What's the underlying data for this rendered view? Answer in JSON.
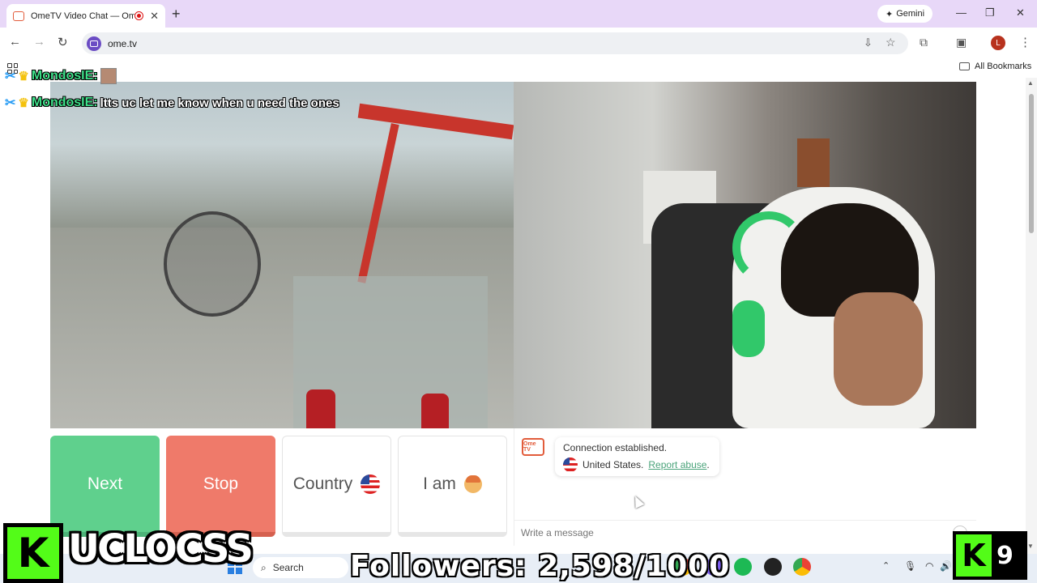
{
  "browser": {
    "tab_title": "OmeTV Video Chat — Ome",
    "new_tab": "+",
    "gemini_label": "Gemini",
    "url": "ome.tv",
    "profile_initial": "L",
    "all_bookmarks": "All Bookmarks"
  },
  "overlay": {
    "row1_name": "MondosIE:",
    "row2_name": "MondosIE:",
    "row2_message": "ltts uc let me know when u need the ones"
  },
  "controls": {
    "next_label": "Next",
    "stop_label": "Stop",
    "country_label": "Country",
    "iam_label": "I am"
  },
  "chat": {
    "logo_text": "Ome TV",
    "status": "Connection established.",
    "country": "United States.",
    "report_label": "Report abuse",
    "report_suffix": ".",
    "input_placeholder": "Write a message"
  },
  "stream": {
    "streamer": "UCLOCSS",
    "followers": "Followers: 2,598/1000",
    "kick_letter": "K",
    "viewer_count": "9"
  },
  "taskbar": {
    "search_label": "Search"
  },
  "colors": {
    "next": "#5fd08d",
    "stop": "#ef7a6a",
    "kick_green": "#53fc18",
    "tab_bar": "#e8d8f8"
  }
}
